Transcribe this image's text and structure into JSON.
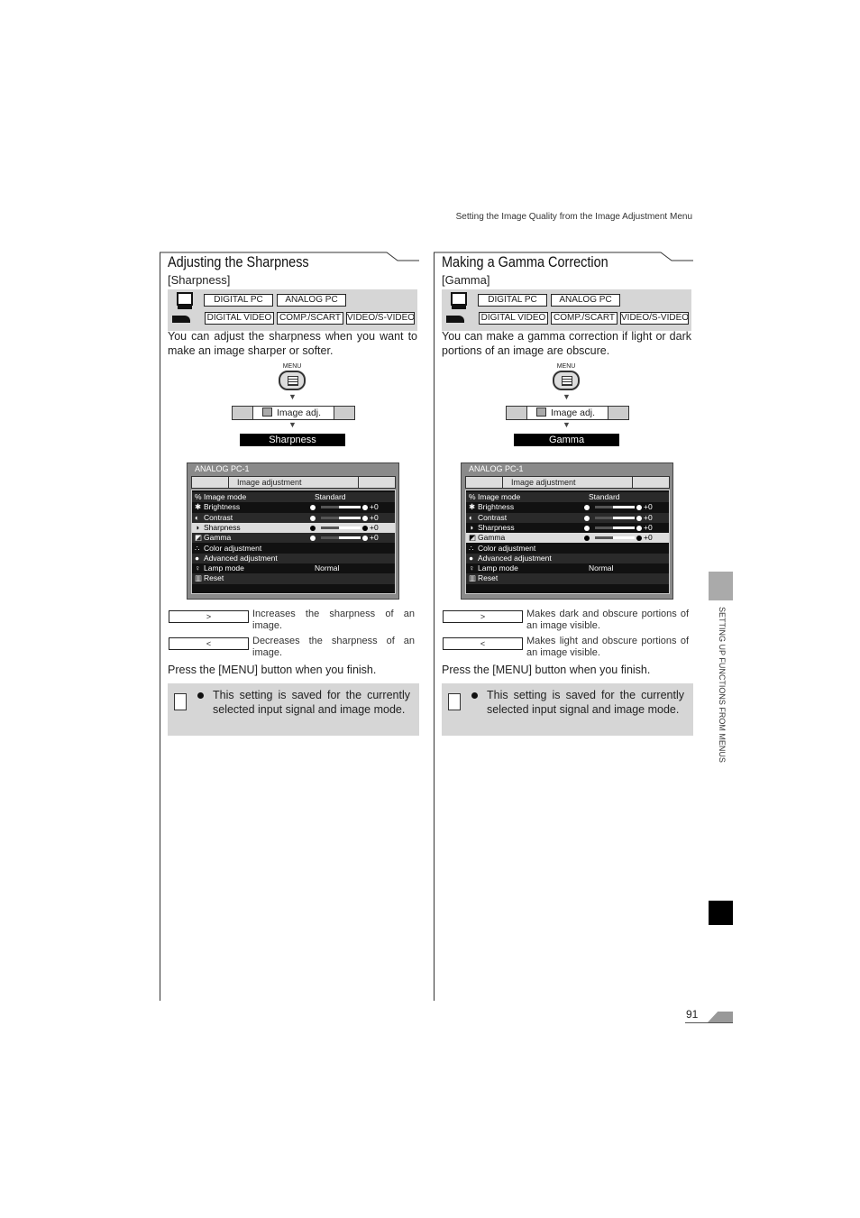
{
  "header": {
    "running_title": "Setting the Image Quality from the Image Adjustment Menu"
  },
  "side_tab": {
    "label": "SETTING UP FUNCTIONS FROM MENUS"
  },
  "page_number": "91",
  "colors": {
    "panel_gray": "#d6d6d6",
    "highlight_row": "#dddddd",
    "black": "#000000"
  },
  "sections": [
    {
      "title": "Adjusting the Sharpness",
      "subtitle": "[Sharpness]",
      "inputs_pc": [
        "DIGITAL PC",
        "ANALOG PC"
      ],
      "inputs_video": [
        "DIGITAL VIDEO",
        "COMP./SCART",
        "VIDEO/S-VIDEO"
      ],
      "description": "You can adjust the sharpness when you want to make an image sharper or softer.",
      "menu_label": "MENU",
      "tab_label": "Image adj.",
      "selected_item": "Sharpness",
      "screen": {
        "source": "ANALOG PC-1",
        "tab": "Image adjustment",
        "highlight": 3,
        "rows": [
          {
            "label": "Image mode",
            "value": "Standard"
          },
          {
            "label": "Brightness",
            "value": "+0",
            "slider": true
          },
          {
            "label": "Contrast",
            "value": "+0",
            "slider": true
          },
          {
            "label": "Sharpness",
            "value": "+0",
            "slider": true
          },
          {
            "label": "Gamma",
            "value": "+0",
            "slider": true
          },
          {
            "label": "Color adjustment",
            "value": ""
          },
          {
            "label": "Advanced adjustment",
            "value": ""
          },
          {
            "label": "Lamp mode",
            "value": "Normal"
          },
          {
            "label": "Reset",
            "value": ""
          }
        ]
      },
      "keys": [
        {
          "key": ">",
          "text": "Increases the sharpness of an image."
        },
        {
          "key": "<",
          "text": "Decreases the sharpness of an image."
        }
      ],
      "finish": "Press the [MENU] button when you finish.",
      "note": "This setting is saved for the currently selected input signal and image mode."
    },
    {
      "title": "Making a Gamma Correction",
      "subtitle": "[Gamma]",
      "inputs_pc": [
        "DIGITAL PC",
        "ANALOG PC"
      ],
      "inputs_video": [
        "DIGITAL VIDEO",
        "COMP./SCART",
        "VIDEO/S-VIDEO"
      ],
      "description": "You can make a gamma correction if light or dark portions of an image are obscure.",
      "menu_label": "MENU",
      "tab_label": "Image adj.",
      "selected_item": "Gamma",
      "screen": {
        "source": "ANALOG PC-1",
        "tab": "Image adjustment",
        "highlight": 4,
        "rows": [
          {
            "label": "Image mode",
            "value": "Standard"
          },
          {
            "label": "Brightness",
            "value": "+0",
            "slider": true
          },
          {
            "label": "Contrast",
            "value": "+0",
            "slider": true
          },
          {
            "label": "Sharpness",
            "value": "+0",
            "slider": true
          },
          {
            "label": "Gamma",
            "value": "+0",
            "slider": true
          },
          {
            "label": "Color adjustment",
            "value": ""
          },
          {
            "label": "Advanced adjustment",
            "value": ""
          },
          {
            "label": "Lamp mode",
            "value": "Normal"
          },
          {
            "label": "Reset",
            "value": ""
          }
        ]
      },
      "keys": [
        {
          "key": ">",
          "text": "Makes dark and obscure portions of an image visible."
        },
        {
          "key": "<",
          "text": "Makes light and obscure portions of an image visible."
        }
      ],
      "finish": "Press the [MENU] button when you finish.",
      "note": "This setting is saved for the currently selected input signal and image mode."
    }
  ]
}
